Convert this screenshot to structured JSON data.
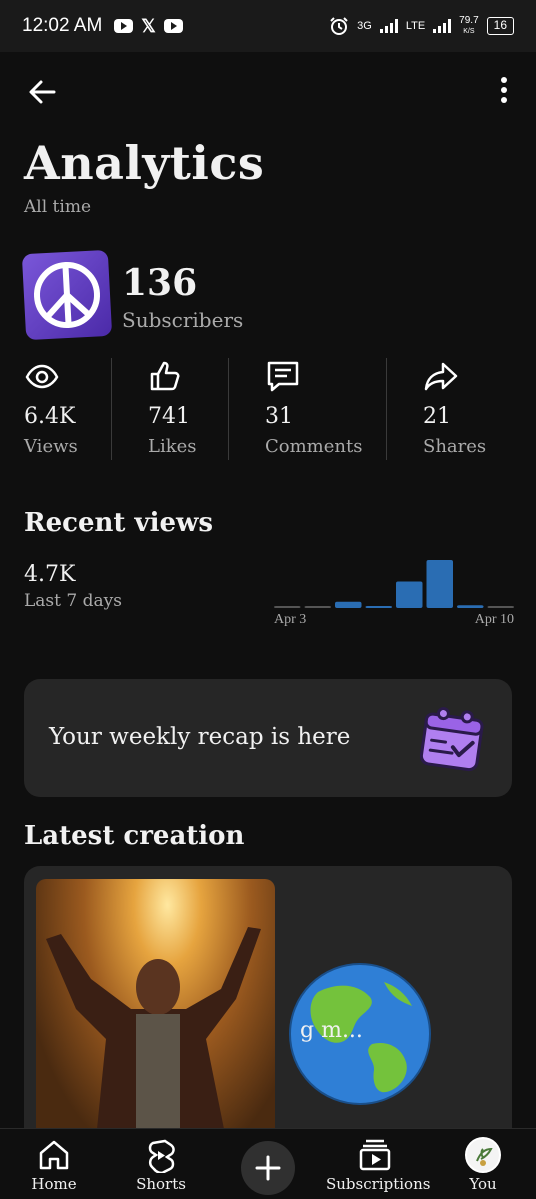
{
  "status_bar": {
    "time": "12:02 AM",
    "left_icons": [
      "youtube-icon",
      "x-icon",
      "youtube-icon"
    ],
    "net_3g": "3G",
    "net_lte": "LTE",
    "speed_value": "79.7",
    "speed_unit": "K/S",
    "battery": "16"
  },
  "header": {
    "title": "Analytics",
    "subtitle": "All time"
  },
  "channel": {
    "subscriber_count": "136",
    "subscriber_label": "Subscribers"
  },
  "stats": [
    {
      "icon": "eye-icon",
      "value": "6.4K",
      "label": "Views"
    },
    {
      "icon": "thumbs-up-icon",
      "value": "741",
      "label": "Likes"
    },
    {
      "icon": "comment-icon",
      "value": "31",
      "label": "Comments"
    },
    {
      "icon": "share-icon",
      "value": "21",
      "label": "Shares"
    }
  ],
  "recent_views": {
    "title": "Recent views",
    "value": "4.7K",
    "label": "Last 7 days",
    "start_label": "Apr 3",
    "end_label": "Apr 10"
  },
  "chart_data": {
    "type": "bar",
    "categories": [
      "",
      "",
      "",
      "",
      "",
      "",
      "",
      ""
    ],
    "values": [
      20,
      20,
      250,
      80,
      1050,
      1900,
      110,
      20
    ],
    "colors": {
      "bar": "#2a6db3",
      "baseline": "#555555"
    },
    "x_tick_labels": [
      "Apr 3",
      "Apr 10"
    ]
  },
  "recap": {
    "text": "Your weekly recap is here",
    "icon": "calendar-check-icon"
  },
  "latest": {
    "title": "Latest creation",
    "video_title_fragment": "g m..."
  },
  "bottom_nav": {
    "home": "Home",
    "shorts": "Shorts",
    "subscriptions": "Subscriptions",
    "you": "You"
  },
  "colors": {
    "background": "#0f0f0f",
    "card": "#262626",
    "accent_purple": "#6a45c9",
    "bar_blue": "#2a6db3"
  }
}
